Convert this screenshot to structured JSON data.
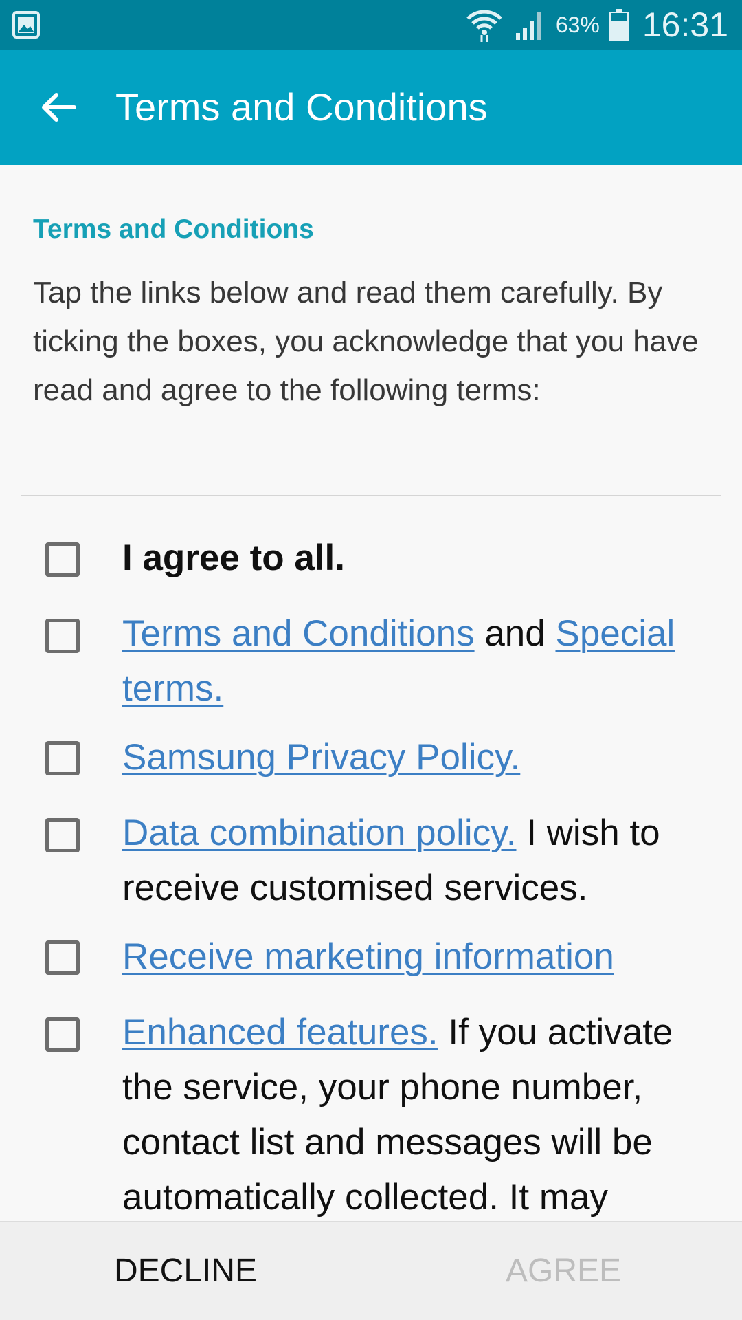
{
  "status_bar": {
    "battery_percent": "63%",
    "time": "16:31",
    "icons": [
      "gallery-notification-icon",
      "wifi-icon",
      "signal-icon",
      "battery-icon"
    ]
  },
  "app_bar": {
    "back_icon": "arrow-left-icon",
    "title": "Terms and Conditions"
  },
  "content": {
    "heading": "Terms and Conditions",
    "intro": "Tap the links below and read them carefully. By ticking the boxes, you acknowledge that you have read and agree to the following terms:",
    "items": [
      {
        "text": "I agree to all.",
        "checked": false
      },
      {
        "link1": "Terms and Conditions",
        "mid": " and ",
        "link2": "Special terms.",
        "checked": false
      },
      {
        "link": "Samsung Privacy Policy.",
        "checked": false
      },
      {
        "link": "Data combination policy.",
        "rest": " I wish to receive customised services.",
        "checked": false
      },
      {
        "link": "Receive marketing information",
        "checked": false
      },
      {
        "link": "Enhanced features.",
        "rest": " If you activate the service, your phone number, contact list and messages will be automatically collected. It may",
        "checked": false
      }
    ]
  },
  "bottom_bar": {
    "decline": "DECLINE",
    "agree": "AGREE",
    "agree_enabled": false
  },
  "colors": {
    "status_bar": "#00819a",
    "app_bar": "#02a2c2",
    "accent_heading": "#17a0b6",
    "link": "#3c7fc4",
    "disabled": "#bdbdbd"
  }
}
